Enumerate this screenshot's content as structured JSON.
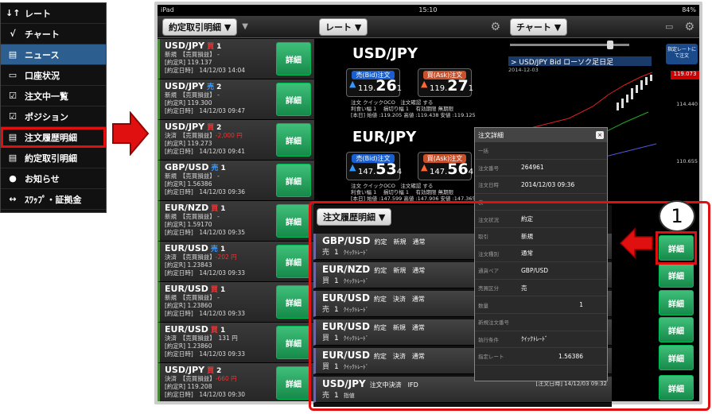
{
  "menu": [
    {
      "icon": "↓↑",
      "label": "レート"
    },
    {
      "icon": "√",
      "label": "チャート"
    },
    {
      "icon": "▤",
      "label": "ニュース"
    },
    {
      "icon": "▭",
      "label": "口座状況"
    },
    {
      "icon": "☑",
      "label": "注文中一覧"
    },
    {
      "icon": "☑",
      "label": "ポジション"
    },
    {
      "icon": "▤",
      "label": "注文履歴明細"
    },
    {
      "icon": "▤",
      "label": "約定取引明細"
    },
    {
      "icon": "●",
      "label": "お知らせ"
    },
    {
      "icon": "↔",
      "label": "ｽﾜｯﾌﾟ・証拠金"
    }
  ],
  "status": {
    "device": "iPad",
    "time": "15:10",
    "battery": "84%"
  },
  "toolbar": {
    "positions": "約定取引明細 ▼",
    "rate": "レート ▼",
    "chart": "チャート ▼"
  },
  "positions": [
    {
      "pair": "USD/JPY",
      "side": "買",
      "num": "1",
      "l2": "新規　【売買損益】 -",
      "l3": "[約定R] 119.137",
      "l4": "[約定日時]　14/12/03 14:04",
      "pl": ""
    },
    {
      "pair": "USD/JPY",
      "side": "売",
      "num": "2",
      "l2": "新規　【売買損益】 -",
      "l3": "[約定R] 119.300",
      "l4": "[約定日時]　14/12/03 09:47",
      "pl": ""
    },
    {
      "pair": "USD/JPY",
      "side": "買",
      "num": "2",
      "l2": "決済　【売買損益】",
      "l3": "[約定R] 119.273",
      "l4": "[約定日時]　14/12/03 09:41",
      "pl": "-2,000 円"
    },
    {
      "pair": "GBP/USD",
      "side": "売",
      "num": "1",
      "l2": "新規　【売買損益】 -",
      "l3": "[約定R] 1.56386",
      "l4": "[約定日時]　14/12/03 09:36",
      "pl": ""
    },
    {
      "pair": "EUR/NZD",
      "side": "買",
      "num": "1",
      "l2": "新規　【売買損益】 -",
      "l3": "[約定R] 1.59170",
      "l4": "[約定日時]　14/12/03 09:35",
      "pl": ""
    },
    {
      "pair": "EUR/USD",
      "side": "売",
      "num": "1",
      "l2": "決済　【売買損益】",
      "l3": "[約定R] 1.23843",
      "l4": "[約定日時]　14/12/03 09:33",
      "pl": "-202 円"
    },
    {
      "pair": "EUR/USD",
      "side": "買",
      "num": "1",
      "l2": "新規　【売買損益】 -",
      "l3": "[約定R] 1.23860",
      "l4": "[約定日時]　14/12/03 09:33",
      "pl": ""
    },
    {
      "pair": "EUR/USD",
      "side": "買",
      "num": "1",
      "l2": "決済　【売買損益】　131 円",
      "l3": "[約定R] 1.23860",
      "l4": "[約定日時]　14/12/03 09:33",
      "pl": ""
    },
    {
      "pair": "USD/JPY",
      "side": "買",
      "num": "2",
      "l2": "決済　【売買損益】",
      "l3": "[約定R] 119.208",
      "l4": "[約定日時]　14/12/03 09:30",
      "pl": "-660 円"
    }
  ],
  "detail_label": "詳細",
  "rates": [
    {
      "pair": "USD/JPY",
      "bid_label": "売(Bid)注文",
      "bid_pre": "119.",
      "bid_big": "26",
      "bid_post": "1",
      "ask_label": "買(Ask)注文",
      "ask_pre": "119.",
      "ask_big": "27",
      "ask_post": "1",
      "info1": "注文 クイックOCO　注文確認 する",
      "info2": "利食い幅 1　 損切り幅 1　 有効期限 無期限",
      "info3": "[本日] 始値 :119.205 高値 :119.438 安値 :119.125"
    },
    {
      "pair": "EUR/JPY",
      "bid_label": "売(Bid)注文",
      "bid_pre": "147.",
      "bid_big": "53",
      "bid_post": "4",
      "ask_label": "買(Ask)注文",
      "ask_pre": "147.",
      "ask_big": "56",
      "ask_post": "4",
      "info1": "注文 クイックOCO　注文確認 する",
      "info2": "利食い幅 1　 損切り幅 1　 有効期限 無期限",
      "info3": "[本日] 始値 :147.599 高値 :147.906 安値 :147.365"
    }
  ],
  "chart": {
    "title": "> USD/JPY  Bid  ローソク足日足",
    "date": "2014-12-03",
    "button": "指定レートにて注文",
    "price_tag": "119.073",
    "y1": "114.440",
    "y2": "110.655"
  },
  "popup": {
    "title": "注文詳細",
    "close": "×",
    "rows": [
      {
        "k": "一括",
        "v": ""
      },
      {
        "k": "注文番号",
        "v": "264961"
      },
      {
        "k": "注文日時",
        "v": "2014/12/03 09:36"
      },
      {
        "k": "表",
        "v": ""
      },
      {
        "k": "注文状況",
        "v": "約定"
      },
      {
        "k": "取引",
        "v": "新規"
      },
      {
        "k": "注文種別",
        "v": "通常"
      },
      {
        "k": "通貨ペア",
        "v": "GBP/USD"
      },
      {
        "k": "売買区分",
        "v": "売"
      },
      {
        "k": "数量",
        "v": "1"
      },
      {
        "k": "新規注文番号",
        "v": ""
      },
      {
        "k": "執行条件",
        "v": "ｸｲｯｸﾄﾚｰﾄﾞ"
      },
      {
        "k": "指定レート",
        "v": "1.56386"
      }
    ]
  },
  "history": {
    "header": "注文履歴明細 ▼",
    "rows": [
      {
        "pair": "GBP/USD",
        "info": "約定　新規　通常",
        "side": "売",
        "num": "1",
        "cond": "ｸｲｯｸﾄﾚｰﾄﾞ",
        "right": "[注文E"
      },
      {
        "pair": "EUR/NZD",
        "info": "約定　新規　通常",
        "side": "買",
        "num": "1",
        "cond": "ｸｲｯｸﾄﾚｰﾄﾞ",
        "right": "[注文E"
      },
      {
        "pair": "EUR/USD",
        "info": "約定　決済　通常",
        "side": "売",
        "num": "1",
        "cond": "ｸｲｯｸﾄﾚｰﾄﾞ",
        "right": "[注文E"
      },
      {
        "pair": "EUR/USD",
        "info": "約定　新規　通常",
        "side": "買",
        "num": "1",
        "cond": "ｸｲｯｸﾄﾚｰﾄﾞ",
        "right": "[注文E"
      },
      {
        "pair": "EUR/USD",
        "info": "約定　決済　通常",
        "side": "買",
        "num": "1",
        "cond": "ｸｲｯｸﾄﾚｰﾄﾞ",
        "right": "[注文E"
      },
      {
        "pair": "USD/JPY",
        "info": "注文中決済　IFD",
        "side": "売",
        "num": "1",
        "cond": "指値",
        "right": "[注文日時] 14/12/03 09:32"
      }
    ]
  },
  "callout": "1"
}
